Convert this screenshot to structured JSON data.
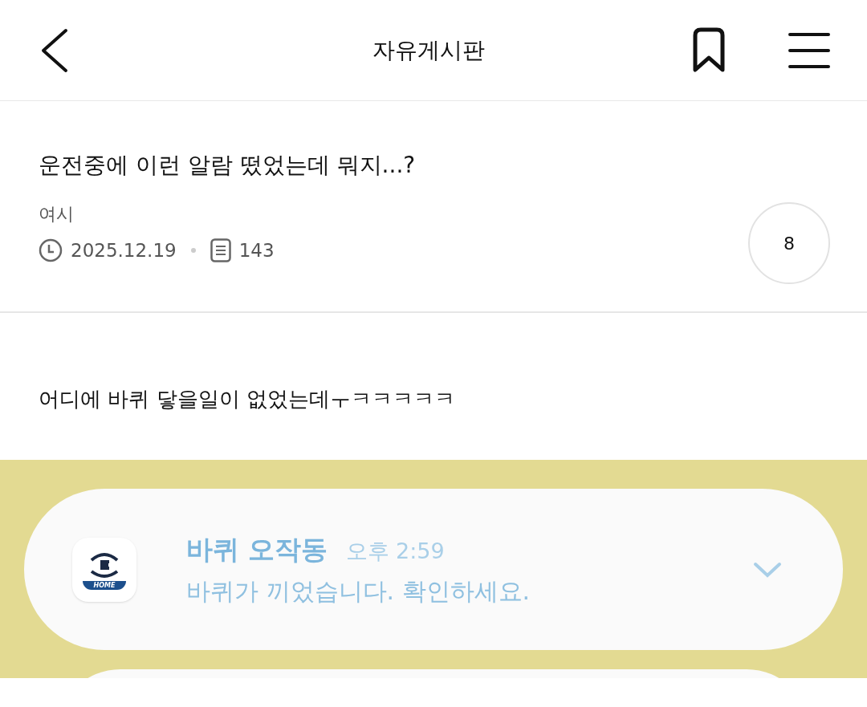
{
  "header": {
    "title": "자유게시판"
  },
  "post": {
    "title": "운전중에 이런 알람 떴었는데 뭐지...?",
    "author": "여시",
    "date": "2025.12.19",
    "views": "143",
    "comments": "8"
  },
  "body": {
    "text": "어디에 바퀴 닿을일이 없었는데ㅜㅋㅋㅋㅋㅋ"
  },
  "notification": {
    "app_icon_label": "HOME",
    "app_name": "바퀴 오작동",
    "time": "오후 2:59",
    "message": "바퀴가 끼었습니다. 확인하세요."
  }
}
